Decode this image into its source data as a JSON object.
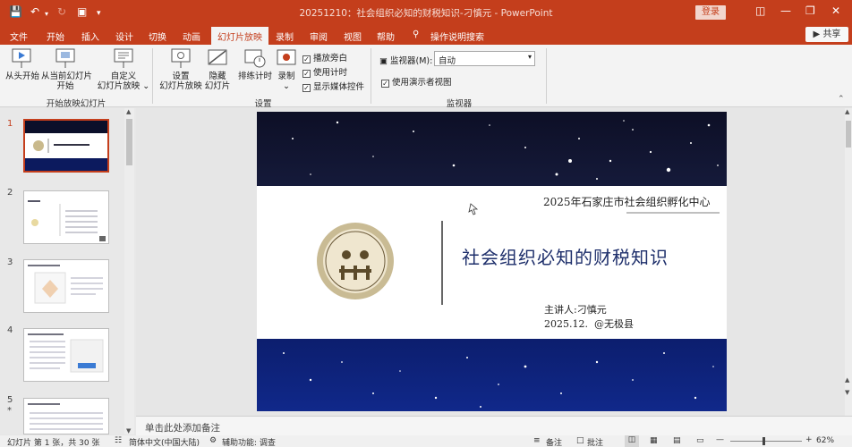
{
  "window": {
    "title": "20251210：社会组织必知的财税知识-刁慎元 - PowerPoint",
    "login": "登录"
  },
  "ribbon_tabs": [
    "文件",
    "开始",
    "插入",
    "设计",
    "切换",
    "动画",
    "幻灯片放映",
    "录制",
    "审阅",
    "视图",
    "帮助"
  ],
  "active_tab": "幻灯片放映",
  "tell_me": "操作说明搜索",
  "share": "共享",
  "ribbon": {
    "start_group": {
      "from_beginning": "从头开始",
      "from_current_1": "从当前幻灯片",
      "from_current_2": "开始",
      "custom_1": "自定义",
      "custom_2": "幻灯片放映",
      "label": "开始放映幻灯片"
    },
    "setup_group": {
      "setup_1": "设置",
      "setup_2": "幻灯片放映",
      "hide_1": "隐藏",
      "hide_2": "幻灯片",
      "rehearse": "排练计时",
      "record": "录制",
      "play_narration": "播放旁白",
      "use_timings": "使用计时",
      "show_media": "显示媒体控件",
      "label": "设置"
    },
    "monitor_group": {
      "monitor_label": "监视器(M):",
      "monitor_value": "自动",
      "presenter_view": "使用演示者视图",
      "label": "监视器"
    }
  },
  "thumbnails": [
    {
      "number": "1"
    },
    {
      "number": "2"
    },
    {
      "number": "3"
    },
    {
      "number": "4"
    },
    {
      "number": "5",
      "marker": "*"
    }
  ],
  "slide": {
    "organizer": "2025年石家庄市社会组织孵化中心",
    "title": "社会组织必知的财税知识",
    "presenter": "主讲人:刁慎元",
    "date_place": "2025.12.  @无极县"
  },
  "notes_placeholder": "单击此处添加备注",
  "status": {
    "slide_info": "幻灯片 第 1 张，共 30 张",
    "language": "简体中文(中国大陆)",
    "accessibility": "辅助功能: 调查",
    "notes": "备注",
    "comments": "批注",
    "zoom": "62%"
  }
}
